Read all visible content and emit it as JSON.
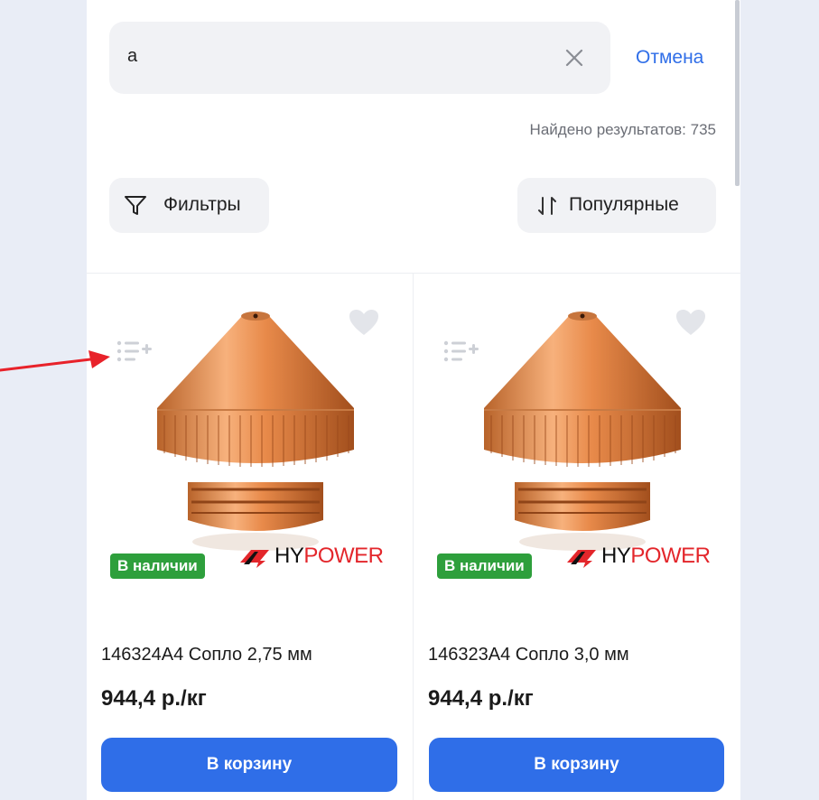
{
  "search": {
    "query": "a",
    "cancel_label": "Отмена",
    "results_label": "Найдено результатов: 735"
  },
  "toolbar": {
    "filters_label": "Фильтры",
    "sort_label": "Популярные"
  },
  "products": [
    {
      "name": "146324A4 Сопло 2,75 мм",
      "price": "944,4 р./кг",
      "stock": "В наличии",
      "brand_hy": "HY",
      "brand_power": "POWER",
      "cart_label": "В корзину"
    },
    {
      "name": "146323A4 Сопло 3,0 мм",
      "price": "944,4 р./кг",
      "stock": "В наличии",
      "brand_hy": "HY",
      "brand_power": "POWER",
      "cart_label": "В корзину"
    }
  ],
  "icons": {
    "clear": "close-icon",
    "filter": "funnel-icon",
    "sort": "sort-arrows-icon",
    "favorite": "heart-icon",
    "compare": "add-to-list-icon"
  },
  "colors": {
    "accent": "#2f6ee8",
    "stock_badge": "#2e9f3c",
    "brand_red": "#e3262b",
    "annotation_arrow": "#e8222a"
  }
}
